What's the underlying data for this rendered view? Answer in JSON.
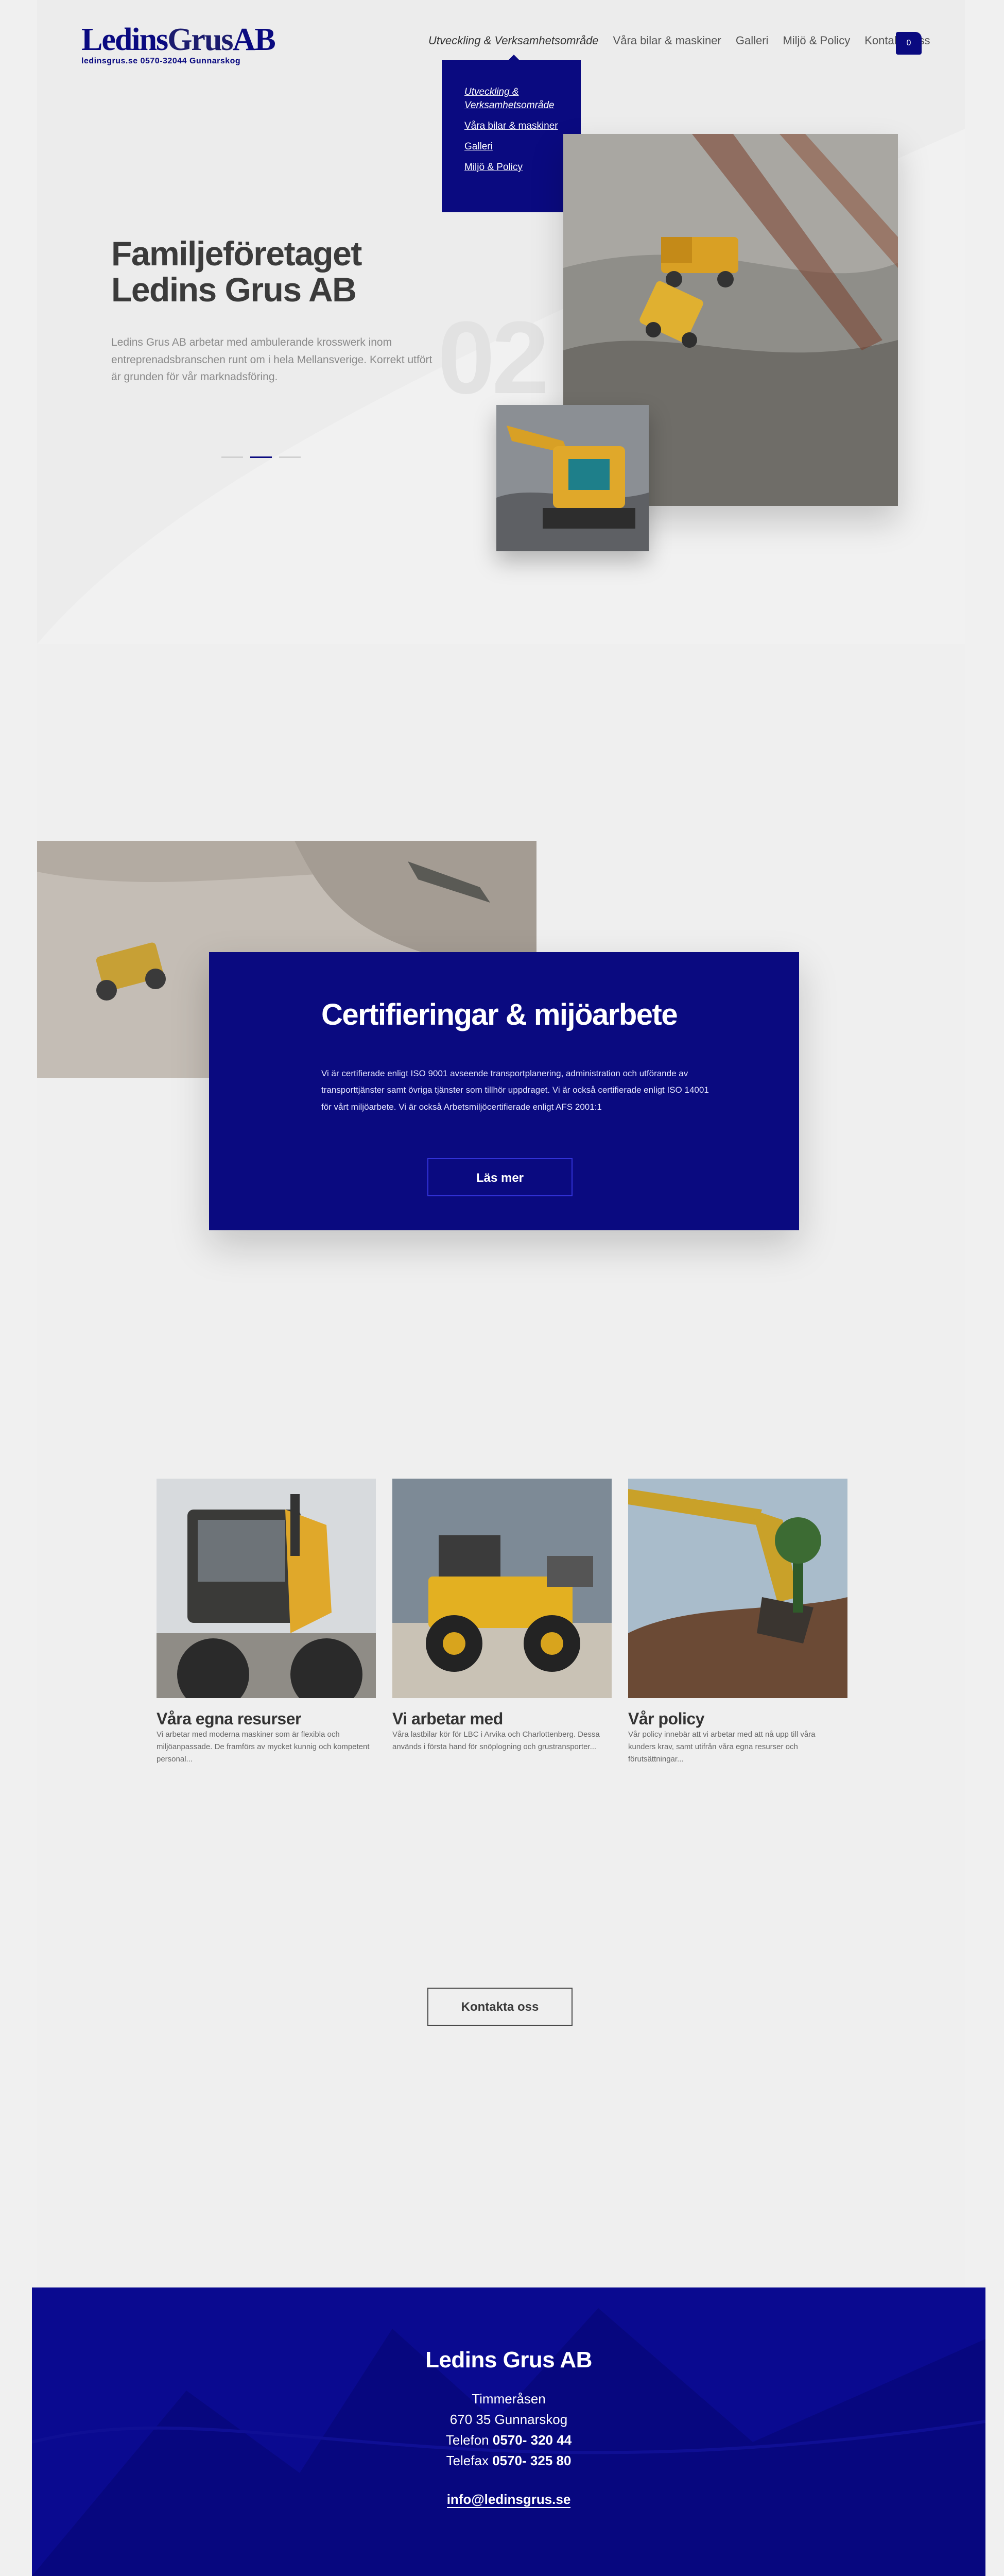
{
  "brand": {
    "logo_main": "Ledins",
    "logo_grus": "Grus",
    "logo_ab": "AB",
    "logo_sub": "ledinsgrus.se  0570-32044  Gunnarskog",
    "accent_color": "#0a0a80"
  },
  "nav": {
    "items": [
      {
        "label": "Utveckling & Verksamhetsområde"
      },
      {
        "label": "Våra bilar & maskiner"
      },
      {
        "label": "Galleri"
      },
      {
        "label": "Miljö & Policy"
      },
      {
        "label": "Kontakta oss"
      }
    ],
    "cart_icon": "cart-icon",
    "cart_count": "0"
  },
  "dropdown": {
    "items": [
      {
        "label": "Utveckling & Verksamhetsområde"
      },
      {
        "label": "Våra bilar & maskiner"
      },
      {
        "label": "Galleri"
      },
      {
        "label": "Miljö & Policy"
      }
    ]
  },
  "hero": {
    "title_line1": "Familjeföretaget",
    "title_line2": "Ledins Grus AB",
    "text": "Ledins Grus AB arbetar med ambulerande krosswerk inom entreprenadsbranschen runt om i hela Mellansverige. Korrekt utfört är grunden för vår marknadsföring.",
    "slide_number": "02",
    "slides_total": 3,
    "slide_active": 2
  },
  "certification": {
    "title": "Certifieringar & mijöarbete",
    "text": "Vi är certifierade enligt ISO 9001 avseende transportplanering, administration och utförande av transporttjänster samt övriga tjänster som tillhör uppdraget. Vi är också certifierade enligt ISO 14001 för vårt miljöarbete. Vi är också Arbetsmiljöcertifierade enligt AFS 2001:1",
    "button": "Läs mer"
  },
  "cards": [
    {
      "title": "Våra egna resurser",
      "text": "Vi arbetar med moderna maskiner som är flexibla och miljöanpassade. De framförs av mycket kunnig och kompetent personal..."
    },
    {
      "title": "Vi arbetar med",
      "text": "Våra lastbilar kör för LBC i Arvika och Charlottenberg. Dessa används i första hand för snöplogning och grustransporter..."
    },
    {
      "title": "Vår policy",
      "text": "Vår policy innebär att vi arbetar med att nå upp till våra kunders krav, samt utifrån våra egna resurser och förutsättningar..."
    }
  ],
  "contact_button": "Kontakta oss",
  "footer": {
    "name": "Ledins Grus AB",
    "address1": "Timmeråsen",
    "address2": "670 35 Gunnarskog",
    "phone_label": "Telefon",
    "phone": "0570- 320 44",
    "fax_label": "Telefax",
    "fax": "0570- 325 80",
    "email": "info@ledinsgrus.se"
  }
}
